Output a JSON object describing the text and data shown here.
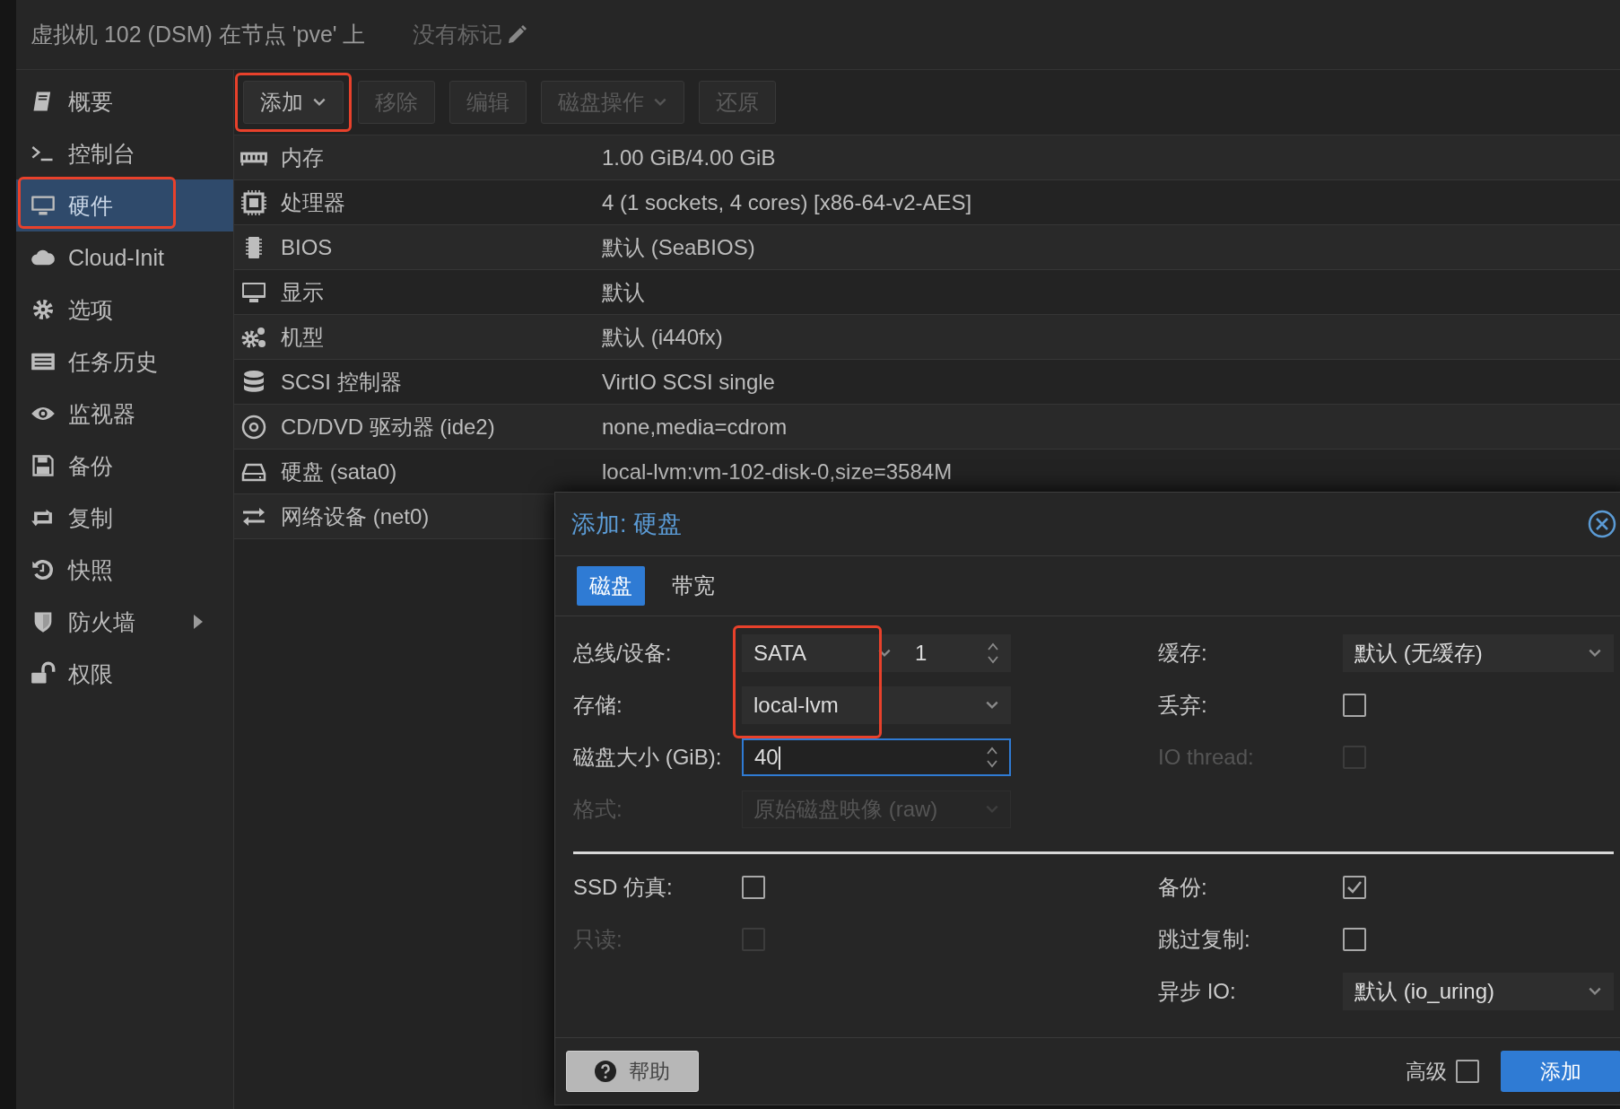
{
  "window": {
    "title": "虚拟机 102 (DSM) 在节点 'pve' 上",
    "tags": "没有标记"
  },
  "sidebar": {
    "items": [
      {
        "label": "概要",
        "selected": false,
        "highlighted": false,
        "expandable": false
      },
      {
        "label": "控制台",
        "selected": false,
        "highlighted": false,
        "expandable": false
      },
      {
        "label": "硬件",
        "selected": true,
        "highlighted": true,
        "expandable": false
      },
      {
        "label": "Cloud-Init",
        "selected": false,
        "highlighted": false,
        "expandable": false
      },
      {
        "label": "选项",
        "selected": false,
        "highlighted": false,
        "expandable": false
      },
      {
        "label": "任务历史",
        "selected": false,
        "highlighted": false,
        "expandable": false
      },
      {
        "label": "监视器",
        "selected": false,
        "highlighted": false,
        "expandable": false
      },
      {
        "label": "备份",
        "selected": false,
        "highlighted": false,
        "expandable": false
      },
      {
        "label": "复制",
        "selected": false,
        "highlighted": false,
        "expandable": false
      },
      {
        "label": "快照",
        "selected": false,
        "highlighted": false,
        "expandable": false
      },
      {
        "label": "防火墙",
        "selected": false,
        "highlighted": false,
        "expandable": true
      },
      {
        "label": "权限",
        "selected": false,
        "highlighted": false,
        "expandable": false
      }
    ]
  },
  "toolbar": [
    {
      "label": "添加",
      "dropdown": true,
      "disabled": false,
      "highlighted": true
    },
    {
      "label": "移除",
      "dropdown": false,
      "disabled": true,
      "highlighted": false
    },
    {
      "label": "编辑",
      "dropdown": false,
      "disabled": true,
      "highlighted": false
    },
    {
      "label": "磁盘操作",
      "dropdown": true,
      "disabled": true,
      "highlighted": false
    },
    {
      "label": "还原",
      "dropdown": false,
      "disabled": true,
      "highlighted": false
    }
  ],
  "hardware": [
    {
      "label": "内存",
      "value": "1.00 GiB/4.00 GiB"
    },
    {
      "label": "处理器",
      "value": "4 (1 sockets, 4 cores) [x86-64-v2-AES]"
    },
    {
      "label": "BIOS",
      "value": "默认 (SeaBIOS)"
    },
    {
      "label": "显示",
      "value": "默认"
    },
    {
      "label": "机型",
      "value": "默认 (i440fx)"
    },
    {
      "label": "SCSI 控制器",
      "value": "VirtIO SCSI single"
    },
    {
      "label": "CD/DVD 驱动器 (ide2)",
      "value": "none,media=cdrom"
    },
    {
      "label": "硬盘 (sata0)",
      "value": "local-lvm:vm-102-disk-0,size=3584M"
    },
    {
      "label": "网络设备 (net0)"
    }
  ],
  "dialog": {
    "title": "添加: 硬盘",
    "tabs": [
      {
        "label": "磁盘",
        "selected": true
      },
      {
        "label": "带宽",
        "selected": false
      }
    ],
    "left_fields": [
      {
        "label": "总线/设备:",
        "kind": "bus",
        "value": "SATA",
        "number": "1",
        "disabled": false,
        "highlighted": true,
        "focused": false
      },
      {
        "label": "存储:",
        "kind": "select",
        "value": "local-lvm",
        "disabled": false,
        "highlighted": true,
        "focused": false
      },
      {
        "label": "磁盘大小 (GiB):",
        "kind": "spinner",
        "value": "40",
        "disabled": false,
        "highlighted": false,
        "focused": true
      },
      {
        "label": "格式:",
        "kind": "select",
        "value": "原始磁盘映像 (raw)",
        "disabled": true,
        "highlighted": false,
        "focused": false
      }
    ],
    "right_fields": [
      {
        "label": "缓存:",
        "kind": "select",
        "value": "默认 (无缓存)",
        "disabled": false
      },
      {
        "label": "丢弃:",
        "kind": "checkbox",
        "checked": false,
        "disabled": false
      },
      {
        "label": "IO thread:",
        "kind": "checkbox",
        "checked": false,
        "disabled": true
      }
    ],
    "advanced_left": [
      {
        "label": "SSD 仿真:",
        "kind": "checkbox",
        "checked": false,
        "disabled": false
      },
      {
        "label": "只读:",
        "kind": "checkbox",
        "checked": false,
        "disabled": true
      }
    ],
    "advanced_right": [
      {
        "label": "备份:",
        "kind": "checkbox",
        "checked": true,
        "disabled": false
      },
      {
        "label": "跳过复制:",
        "kind": "checkbox",
        "checked": false,
        "disabled": false
      },
      {
        "label": "异步 IO:",
        "kind": "select",
        "value": "默认 (io_uring)",
        "disabled": false
      }
    ],
    "help_button": "帮助",
    "advanced": {
      "label": "高级",
      "checked": false
    },
    "submit_button": "添加"
  }
}
